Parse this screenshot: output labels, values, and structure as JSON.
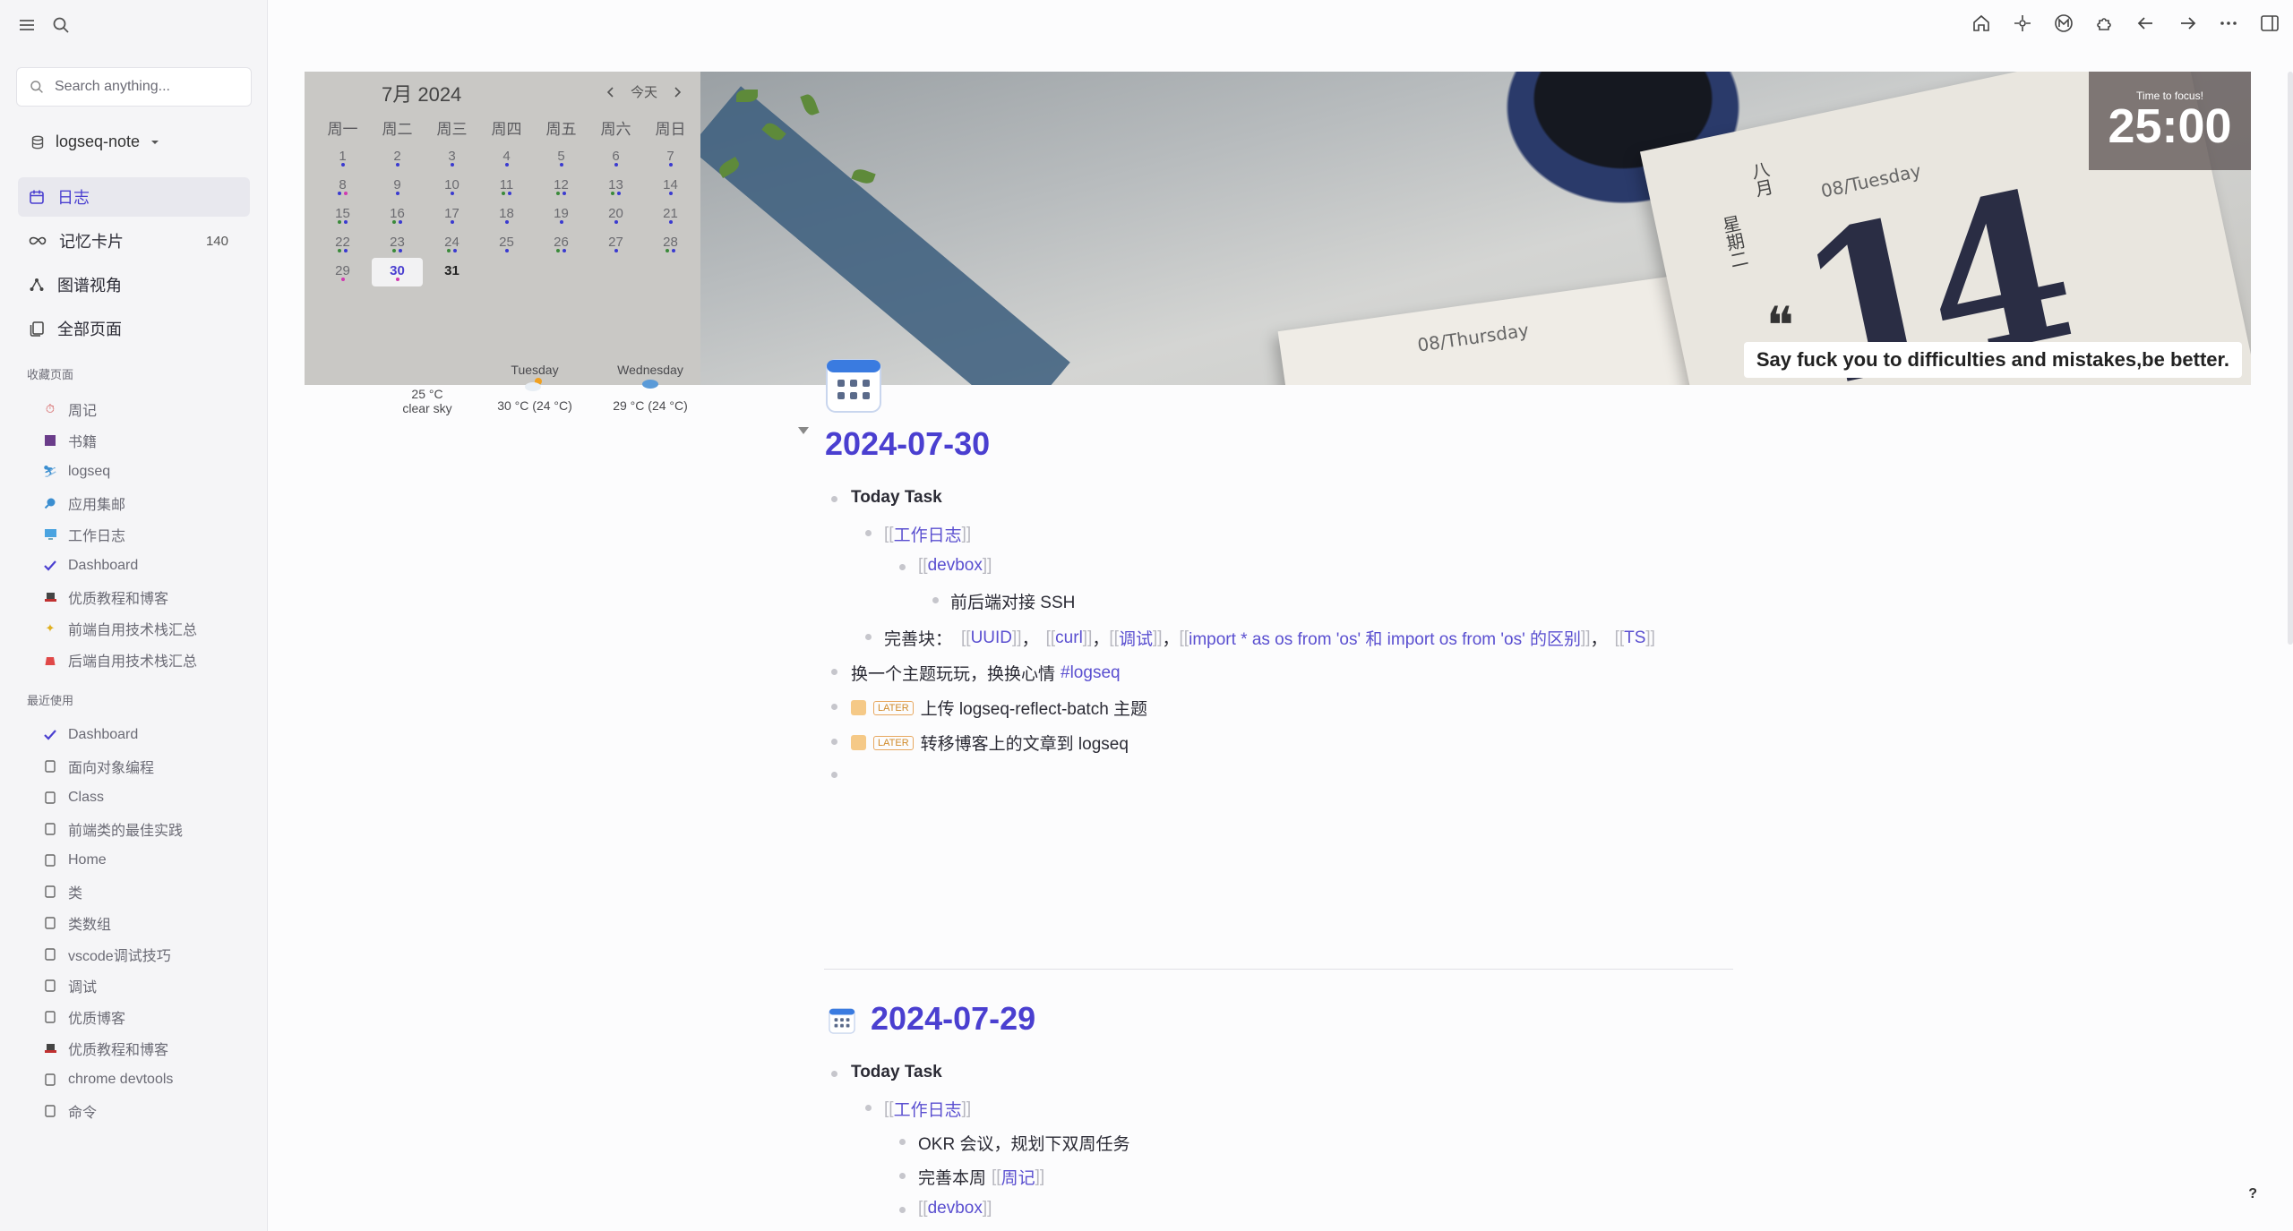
{
  "sidebar": {
    "search_placeholder": "Search anything...",
    "graph_name": "logseq-note",
    "nav": [
      {
        "label": "日志",
        "count": ""
      },
      {
        "label": "记忆卡片",
        "count": "140"
      },
      {
        "label": "图谱视角",
        "count": ""
      },
      {
        "label": "全部页面",
        "count": ""
      }
    ],
    "favorites_title": "收藏页面",
    "favorites": [
      "周记",
      "书籍",
      "logseq",
      "应用集邮",
      "工作日志",
      "Dashboard",
      "优质教程和博客",
      "前端自用技术栈汇总",
      "后端自用技术栈汇总"
    ],
    "recent_title": "最近使用",
    "recent": [
      "Dashboard",
      "面向对象编程",
      "Class",
      "前端类的最佳实践",
      "Home",
      "类",
      "类数组",
      "vscode调试技巧",
      "调试",
      "优质博客",
      "优质教程和博客",
      "chrome devtools",
      "命令"
    ]
  },
  "calendar": {
    "month_label": "7月 2024",
    "today_label": "今天",
    "weekdays": [
      "周一",
      "周二",
      "周三",
      "周四",
      "周五",
      "周六",
      "周日"
    ],
    "weeks": [
      [
        "1",
        "2",
        "3",
        "4",
        "5",
        "6",
        "7"
      ],
      [
        "8",
        "9",
        "10",
        "11",
        "12",
        "13",
        "14"
      ],
      [
        "15",
        "16",
        "17",
        "18",
        "19",
        "20",
        "21"
      ],
      [
        "22",
        "23",
        "24",
        "25",
        "26",
        "27",
        "28"
      ],
      [
        "29",
        "30",
        "31",
        "",
        "",
        "",
        ""
      ]
    ]
  },
  "weather": {
    "now_temp": "25 °C",
    "now_desc": "clear sky",
    "day1_name": "Tuesday",
    "day1_temp": "30 °C (24 °C)",
    "day2_name": "Wednesday",
    "day2_temp": "29 °C (24 °C)"
  },
  "banner": {
    "timer_label": "Time to focus!",
    "timer_value": "25:00",
    "quote": "Say fuck you to difficulties and mistakes,be better.",
    "photo_texts": [
      "08/Tuesday",
      "08/Thursday",
      "八月",
      "星期二",
      "14"
    ]
  },
  "journal1": {
    "title": "2024-07-30",
    "today_task": "Today Task",
    "ref_worklog": "工作日志",
    "ref_devbox": "devbox",
    "ssh": "前后端对接 SSH",
    "improve_label": "完善块：",
    "refs": [
      "UUID",
      "curl",
      "调试",
      "import * as os from 'os' 和 import os from 'os' 的区别",
      "TS"
    ],
    "theme_text": "换一个主题玩玩，换换心情",
    "theme_tag": "#logseq",
    "later_label": "LATER",
    "task1": "上传 logseq-reflect-batch 主题",
    "task2": "转移博客上的文章到 logseq"
  },
  "journal2": {
    "title": "2024-07-29",
    "today_task": "Today Task",
    "ref_worklog": "工作日志",
    "okr": "OKR 会议，规划下双周任务",
    "improve": "完善本周",
    "ref_weekly": "周记",
    "ref_devbox": "devbox"
  },
  "help": "?"
}
